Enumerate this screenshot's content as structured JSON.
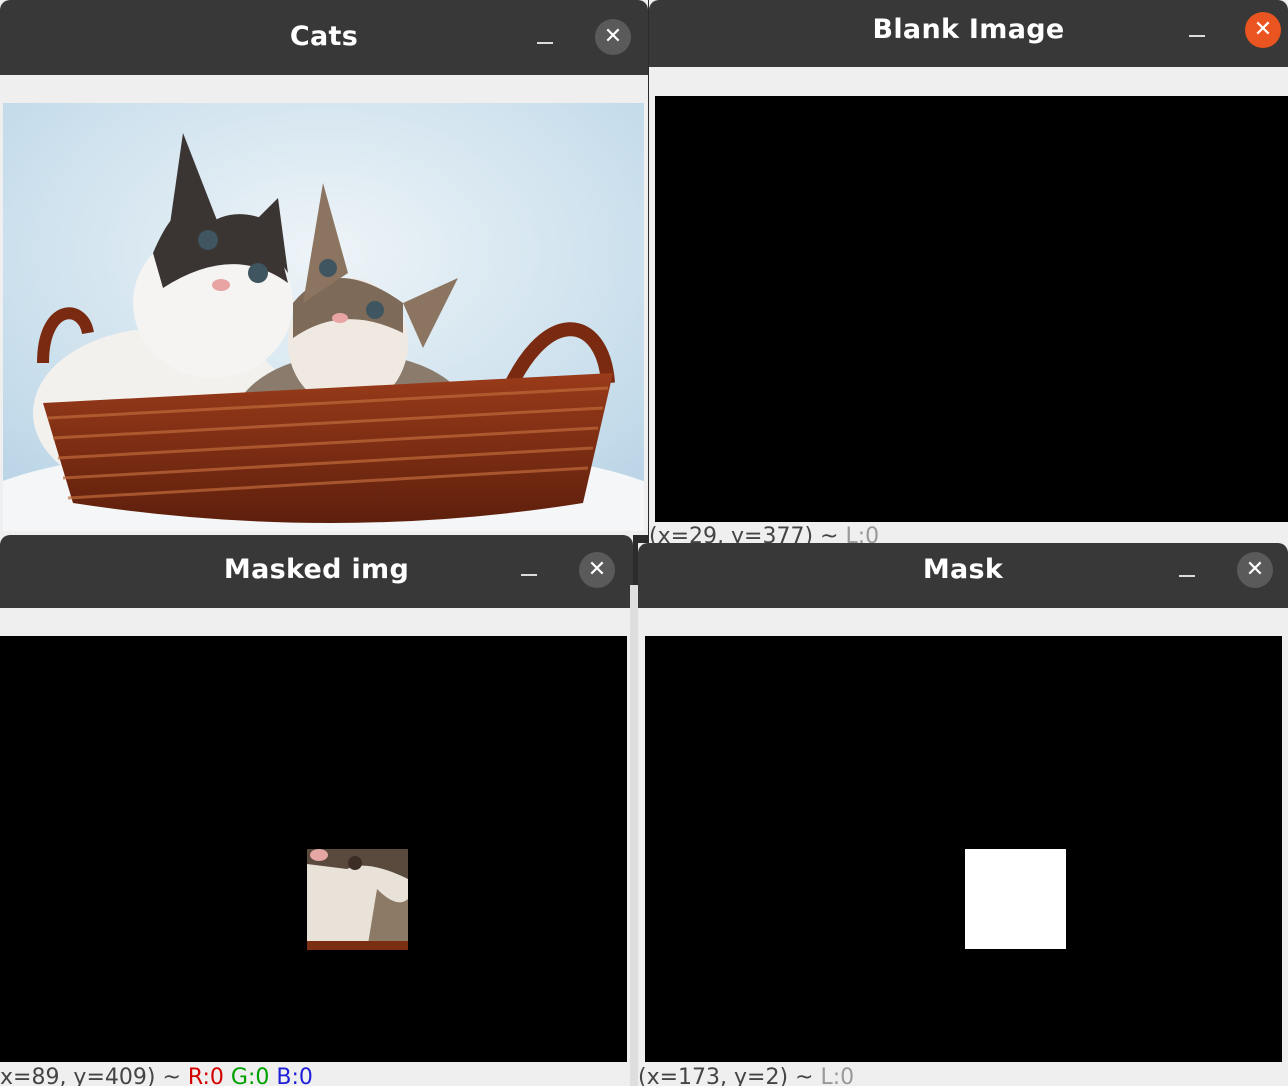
{
  "windows": {
    "cats": {
      "title": "Cats",
      "close_glyph": "✕"
    },
    "blank": {
      "title": "Blank Image",
      "close_glyph": "✕",
      "status": {
        "coords": "(x=29, y=377) ~ ",
        "channel": "L:0"
      }
    },
    "masked": {
      "title": "Masked img",
      "close_glyph": "✕",
      "status": {
        "coords": "x=89, y=409) ~ ",
        "r": "R:0",
        "g": "G:0",
        "b": "B:0"
      }
    },
    "mask": {
      "title": "Mask",
      "close_glyph": "✕",
      "status": {
        "coords": "(x=173, y=2) ~ ",
        "channel": "L:0"
      }
    }
  },
  "colors": {
    "titlebar": "#383838",
    "close_active": "#e95420",
    "close_inactive": "#5a5a5a",
    "canvas": "#000000",
    "mask_square": "#ffffff"
  },
  "icons": [
    "minimize-icon",
    "close-icon",
    "cats-in-basket-photo"
  ]
}
